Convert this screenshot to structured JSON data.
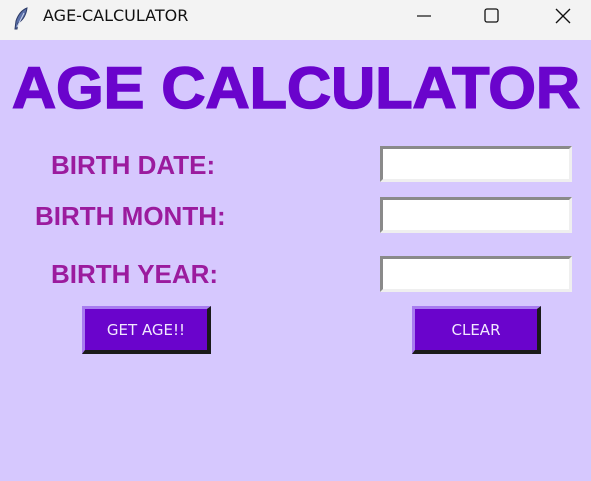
{
  "window": {
    "title": "AGE-CALCULATOR",
    "icon": "feather-icon",
    "controls": [
      "minimize-icon",
      "maximize-icon",
      "close-icon"
    ]
  },
  "app": {
    "heading": "AGE CALCULATOR",
    "heading_color": "#6a04cc",
    "background_color": "#d6c8fe",
    "label_color": "#9b1b9e"
  },
  "form": {
    "birth_date_label": "BIRTH DATE:",
    "birth_month_label": "BIRTH MONTH:",
    "birth_year_label": "BIRTH YEAR:",
    "birth_date_value": "",
    "birth_month_value": "",
    "birth_year_value": ""
  },
  "buttons": {
    "get_age_label": "GET AGE!!",
    "clear_label": "CLEAR",
    "button_color": "#6a04cc"
  }
}
